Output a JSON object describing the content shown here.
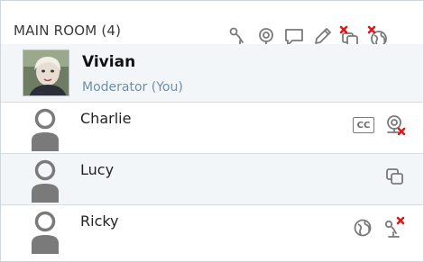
{
  "room": {
    "title": "MAIN ROOM (4)",
    "header_icons": [
      "microphone-icon",
      "webcam-icon",
      "chat-icon",
      "pencil-icon",
      "screenshare-icon",
      "globe-icon"
    ]
  },
  "moderator": {
    "name": "Vivian",
    "role": "Moderator (You)"
  },
  "participants": [
    {
      "name": "Charlie",
      "icons": [
        "closed-captions-icon",
        "webcam-blocked-icon"
      ]
    },
    {
      "name": "Lucy",
      "icons": [
        "screenshare-icon"
      ]
    },
    {
      "name": "Ricky",
      "icons": [
        "globe-icon",
        "microphone-blocked-icon"
      ]
    }
  ],
  "colors": {
    "role_text": "#6f8fa8",
    "alt_row": "#f3f6f9",
    "icon_gray": "#7a7a7a",
    "blocked_red": "#e01818"
  },
  "cc_label": "CC"
}
